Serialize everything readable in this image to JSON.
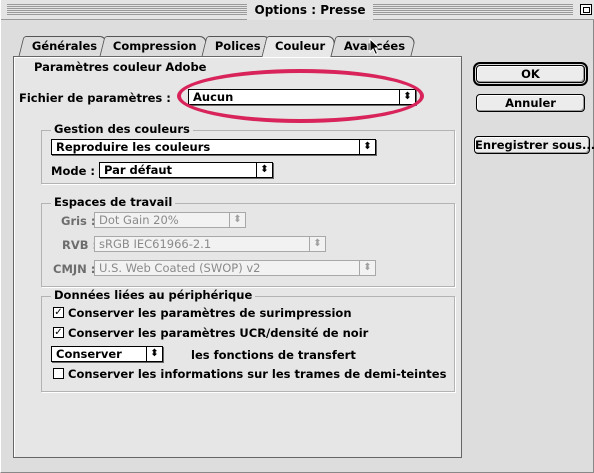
{
  "window": {
    "title": "Options : Presse"
  },
  "tabs": [
    {
      "label": "Générales"
    },
    {
      "label": "Compression"
    },
    {
      "label": "Polices"
    },
    {
      "label": "Couleur"
    },
    {
      "label": "Avancées"
    }
  ],
  "active_tab": "Couleur",
  "adobe_settings": {
    "group_label": "Paramètres couleur Adobe",
    "file_label": "Fichier de paramètres :",
    "file_value": "Aucun"
  },
  "color_management": {
    "group_label": "Gestion des couleurs",
    "policy_value": "Reproduire les couleurs",
    "mode_label": "Mode :",
    "mode_value": "Par défaut"
  },
  "workspaces": {
    "group_label": "Espaces de travail",
    "gray_label": "Gris :",
    "gray_value": "Dot Gain 20%",
    "rgb_label": "RVB :",
    "rgb_value": "sRGB IEC61966-2.1",
    "cmyk_label": "CMJN :",
    "cmyk_value": "U.S. Web Coated (SWOP) v2"
  },
  "device_data": {
    "group_label": "Données liées au périphérique",
    "overprint_label": "Conserver les paramètres de surimpression",
    "overprint_checked": true,
    "ucr_label": "Conserver les paramètres UCR/densité de noir",
    "ucr_checked": true,
    "transfer_value": "Conserver",
    "transfer_label": "les fonctions de transfert",
    "halftone_label": "Conserver les informations sur les trames de demi-teintes",
    "halftone_checked": false
  },
  "buttons": {
    "ok": "OK",
    "cancel": "Annuler",
    "save_as": "Enregistrer sous..."
  },
  "annotation_color": "#d8245a"
}
